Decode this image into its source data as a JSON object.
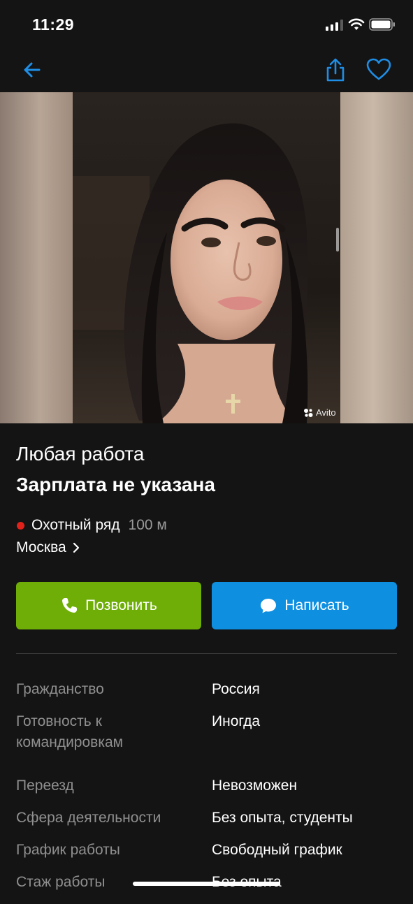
{
  "status_bar": {
    "time": "11:29"
  },
  "listing": {
    "title": "Любая работа",
    "salary": "Зарплата не указана",
    "metro": {
      "station": "Охотный ряд",
      "distance": "100 м",
      "line_color": "#e0221b"
    },
    "city": "Москва",
    "watermark": "Avito"
  },
  "actions": {
    "call_label": "Позвонить",
    "message_label": "Написать",
    "call_color": "#6eae07",
    "message_color": "#0e8fe0"
  },
  "params": [
    {
      "key": "Гражданство",
      "value": "Россия"
    },
    {
      "key": "Готовность к командировкам",
      "value": "Иногда"
    },
    {
      "key": "Переезд",
      "value": "Невозможен"
    },
    {
      "key": "Сфера деятельности",
      "value": "Без опыта, студенты"
    },
    {
      "key": "График работы",
      "value": "Свободный график"
    },
    {
      "key": "Стаж работы",
      "value": "Без опыта"
    }
  ],
  "icons": {
    "back": "arrow-left-icon",
    "share": "share-icon",
    "favorite": "heart-icon",
    "phone": "phone-icon",
    "message": "chat-bubble-icon",
    "chevron": "chevron-right-icon"
  },
  "colors": {
    "accent": "#0e8fe0",
    "background": "#141414"
  }
}
